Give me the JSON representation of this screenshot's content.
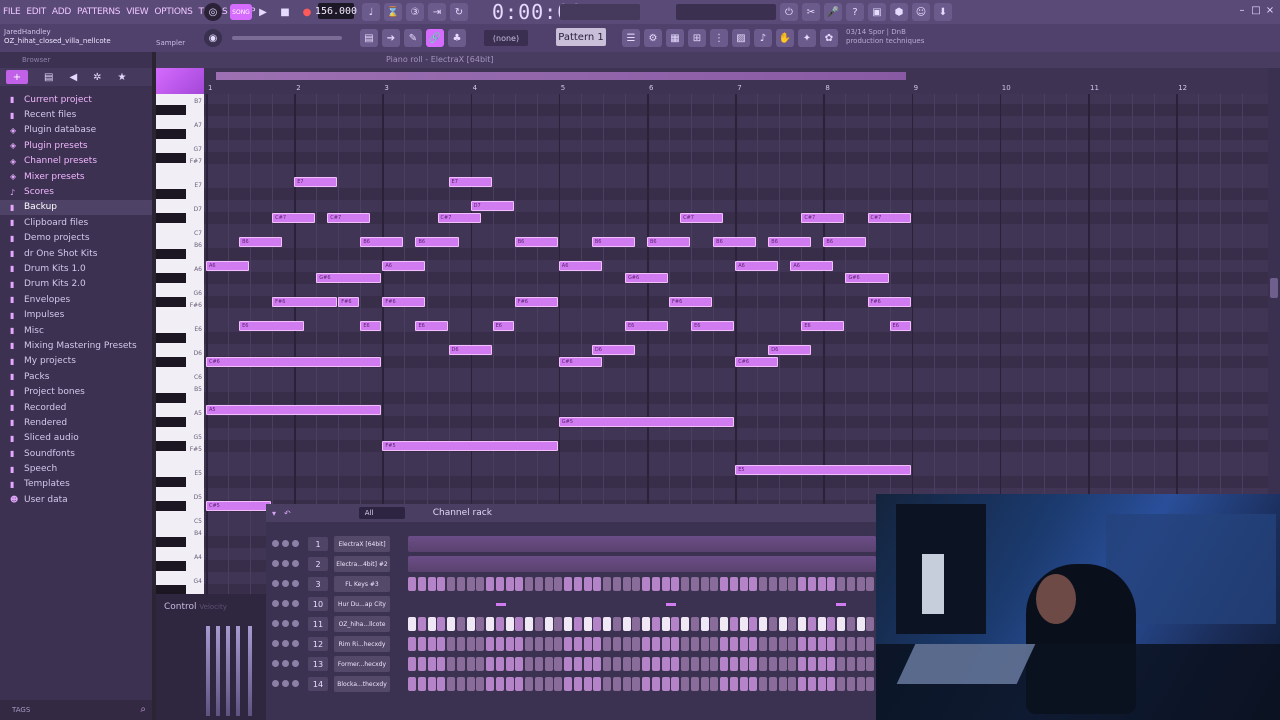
{
  "menubar": {
    "items": [
      "FILE",
      "EDIT",
      "ADD",
      "PATTERNS",
      "VIEW",
      "OPTIONS",
      "TOOLS",
      "HELP"
    ],
    "tempo": "156.000",
    "time": "0:00:00",
    "mode_badge": "SONG"
  },
  "project": {
    "user": "JaredHandley",
    "file": "OZ_hihat_closed_villa_nellcote",
    "plugin_label": "Sampler"
  },
  "toolbar": {
    "snap": "(none)",
    "pattern": "Pattern 1",
    "hint_line1": "03/14  Spor | DnB",
    "hint_line2": "production techniques"
  },
  "browser": {
    "title": "Browser",
    "items": [
      {
        "label": "Current project",
        "icon": "folder-icon",
        "pink": true
      },
      {
        "label": "Recent files",
        "icon": "folder-icon"
      },
      {
        "label": "Plugin database",
        "icon": "plug-icon"
      },
      {
        "label": "Plugin presets",
        "icon": "plug-icon",
        "pink": true
      },
      {
        "label": "Channel presets",
        "icon": "plug-icon",
        "pink": true
      },
      {
        "label": "Mixer presets",
        "icon": "plug-icon",
        "pink": true
      },
      {
        "label": "Scores",
        "icon": "note-icon",
        "pink": true
      },
      {
        "label": "Backup",
        "icon": "folder-icon",
        "highlight": true
      },
      {
        "label": "Clipboard files",
        "icon": "folder-icon"
      },
      {
        "label": "Demo projects",
        "icon": "folder-icon"
      },
      {
        "label": "dr One Shot Kits",
        "icon": "folder-icon"
      },
      {
        "label": "Drum Kits 1.0",
        "icon": "folder-icon"
      },
      {
        "label": "Drum Kits 2.0",
        "icon": "folder-icon"
      },
      {
        "label": "Envelopes",
        "icon": "folder-icon"
      },
      {
        "label": "Impulses",
        "icon": "folder-icon"
      },
      {
        "label": "Misc",
        "icon": "folder-icon"
      },
      {
        "label": "Mixing Mastering Presets",
        "icon": "folder-icon"
      },
      {
        "label": "My projects",
        "icon": "folder-icon"
      },
      {
        "label": "Packs",
        "icon": "folder-icon"
      },
      {
        "label": "Project bones",
        "icon": "folder-icon"
      },
      {
        "label": "Recorded",
        "icon": "folder-icon"
      },
      {
        "label": "Rendered",
        "icon": "folder-icon"
      },
      {
        "label": "Sliced audio",
        "icon": "folder-icon"
      },
      {
        "label": "Soundfonts",
        "icon": "folder-icon"
      },
      {
        "label": "Speech",
        "icon": "folder-icon"
      },
      {
        "label": "Templates",
        "icon": "folder-icon"
      },
      {
        "label": "User data",
        "icon": "user-icon"
      }
    ],
    "tags_label": "TAGS"
  },
  "piano_roll": {
    "title": "Piano roll - ElectraX [64bit]",
    "bars": [
      "1",
      "2",
      "3",
      "4",
      "5",
      "6",
      "7",
      "8",
      "9",
      "10",
      "11",
      "12"
    ],
    "key_labels": [
      {
        "label": "B7",
        "row": 1
      },
      {
        "label": "A7",
        "row": 3
      },
      {
        "label": "G7",
        "row": 5
      },
      {
        "label": "F#7",
        "row": 6
      },
      {
        "label": "E7",
        "row": 8
      },
      {
        "label": "D7",
        "row": 10
      },
      {
        "label": "C7",
        "row": 12
      },
      {
        "label": "B6",
        "row": 13
      },
      {
        "label": "A6",
        "row": 15
      },
      {
        "label": "G6",
        "row": 17
      },
      {
        "label": "F#6",
        "row": 18
      },
      {
        "label": "E6",
        "row": 20
      },
      {
        "label": "D6",
        "row": 22
      },
      {
        "label": "C6",
        "row": 24
      },
      {
        "label": "B5",
        "row": 25
      },
      {
        "label": "A5",
        "row": 27
      },
      {
        "label": "G5",
        "row": 29
      },
      {
        "label": "F#5",
        "row": 30
      },
      {
        "label": "E5",
        "row": 32
      },
      {
        "label": "D5",
        "row": 34
      },
      {
        "label": "C5",
        "row": 36
      },
      {
        "label": "B4",
        "row": 37
      },
      {
        "label": "A4",
        "row": 39
      },
      {
        "label": "G4",
        "row": 41
      }
    ],
    "notes": [
      {
        "label": "E7",
        "row": 8,
        "start": 1.0,
        "len": 0.5
      },
      {
        "label": "E7",
        "row": 8,
        "start": 2.75,
        "len": 0.5
      },
      {
        "label": "D7",
        "row": 10,
        "start": 3.0,
        "len": 0.5
      },
      {
        "label": "C#7",
        "row": 11,
        "start": 0.75,
        "len": 0.5
      },
      {
        "label": "C#7",
        "row": 11,
        "start": 1.375,
        "len": 0.5
      },
      {
        "label": "C#7",
        "row": 11,
        "start": 2.625,
        "len": 0.5
      },
      {
        "label": "C#7",
        "row": 11,
        "start": 5.375,
        "len": 0.5
      },
      {
        "label": "C#7",
        "row": 11,
        "start": 6.75,
        "len": 0.5
      },
      {
        "label": "C#7",
        "row": 11,
        "start": 7.5,
        "len": 0.5
      },
      {
        "label": "B6",
        "row": 13,
        "start": 0.375,
        "len": 0.5
      },
      {
        "label": "B6",
        "row": 13,
        "start": 1.75,
        "len": 0.5
      },
      {
        "label": "B6",
        "row": 13,
        "start": 2.375,
        "len": 0.5
      },
      {
        "label": "B6",
        "row": 13,
        "start": 3.5,
        "len": 0.5
      },
      {
        "label": "B6",
        "row": 13,
        "start": 4.375,
        "len": 0.5
      },
      {
        "label": "B6",
        "row": 13,
        "start": 5.0,
        "len": 0.5
      },
      {
        "label": "B6",
        "row": 13,
        "start": 5.75,
        "len": 0.5
      },
      {
        "label": "B6",
        "row": 13,
        "start": 6.375,
        "len": 0.5
      },
      {
        "label": "B6",
        "row": 13,
        "start": 7.0,
        "len": 0.5
      },
      {
        "label": "A6",
        "row": 15,
        "start": 0.0,
        "len": 0.5
      },
      {
        "label": "A6",
        "row": 15,
        "start": 2.0,
        "len": 0.5
      },
      {
        "label": "A6",
        "row": 15,
        "start": 4.0,
        "len": 0.5
      },
      {
        "label": "A6",
        "row": 15,
        "start": 6.0,
        "len": 0.5
      },
      {
        "label": "A6",
        "row": 15,
        "start": 6.625,
        "len": 0.5
      },
      {
        "label": "G#6",
        "row": 16,
        "start": 1.25,
        "len": 0.75
      },
      {
        "label": "G#6",
        "row": 16,
        "start": 4.75,
        "len": 0.5
      },
      {
        "label": "G#6",
        "row": 16,
        "start": 7.25,
        "len": 0.5
      },
      {
        "label": "F#6",
        "row": 18,
        "start": 0.75,
        "len": 0.75
      },
      {
        "label": "F#6",
        "row": 18,
        "start": 1.5,
        "len": 0.25
      },
      {
        "label": "F#6",
        "row": 18,
        "start": 2.0,
        "len": 0.5
      },
      {
        "label": "F#6",
        "row": 18,
        "start": 3.5,
        "len": 0.5
      },
      {
        "label": "F#6",
        "row": 18,
        "start": 5.25,
        "len": 0.5
      },
      {
        "label": "F#6",
        "row": 18,
        "start": 7.5,
        "len": 0.5
      },
      {
        "label": "E6",
        "row": 20,
        "start": 0.375,
        "len": 0.75
      },
      {
        "label": "E6",
        "row": 20,
        "start": 1.75,
        "len": 0.25
      },
      {
        "label": "E6",
        "row": 20,
        "start": 2.375,
        "len": 0.375
      },
      {
        "label": "E6",
        "row": 20,
        "start": 3.25,
        "len": 0.25
      },
      {
        "label": "E6",
        "row": 20,
        "start": 4.75,
        "len": 0.5
      },
      {
        "label": "E6",
        "row": 20,
        "start": 5.5,
        "len": 0.5
      },
      {
        "label": "E6",
        "row": 20,
        "start": 6.75,
        "len": 0.5
      },
      {
        "label": "E6",
        "row": 20,
        "start": 7.75,
        "len": 0.25
      },
      {
        "label": "D6",
        "row": 22,
        "start": 2.75,
        "len": 0.5
      },
      {
        "label": "D6",
        "row": 22,
        "start": 4.375,
        "len": 0.5
      },
      {
        "label": "D6",
        "row": 22,
        "start": 6.375,
        "len": 0.5
      },
      {
        "label": "C#6",
        "row": 23,
        "start": 0.0,
        "len": 2.0
      },
      {
        "label": "C#6",
        "row": 23,
        "start": 4.0,
        "len": 0.5
      },
      {
        "label": "C#6",
        "row": 23,
        "start": 6.0,
        "len": 0.5
      },
      {
        "label": "A5",
        "row": 27,
        "start": 0.0,
        "len": 2.0
      },
      {
        "label": "G#5",
        "row": 28,
        "start": 4.0,
        "len": 2.0
      },
      {
        "label": "F#5",
        "row": 30,
        "start": 2.0,
        "len": 2.0
      },
      {
        "label": "E5",
        "row": 32,
        "start": 6.0,
        "len": 2.0
      },
      {
        "label": "C#5",
        "row": 35,
        "start": 0.0,
        "len": 0.75
      }
    ]
  },
  "control": {
    "label": "Control",
    "sub": "Velocity"
  },
  "channel_rack": {
    "filter": "All",
    "title": "Channel rack",
    "channels": [
      {
        "num": "1",
        "name": "ElectraX [64bit]",
        "kind": "pattern"
      },
      {
        "num": "2",
        "name": "Electra...4bit] #2",
        "kind": "pattern"
      },
      {
        "num": "3",
        "name": "FL Keys #3",
        "kind": "steps",
        "on": []
      },
      {
        "num": "10",
        "name": "Hur Du...ap City",
        "kind": "pattern-small"
      },
      {
        "num": "11",
        "name": "OZ_hiha...llcote",
        "kind": "steps",
        "on": [
          0,
          2,
          4,
          6,
          8,
          10,
          12,
          14,
          16,
          18,
          20,
          22,
          24,
          26,
          28,
          30,
          32,
          34,
          36,
          38,
          40,
          42,
          44,
          46
        ]
      },
      {
        "num": "12",
        "name": "Rim Ri...hecxdy",
        "kind": "steps",
        "on": []
      },
      {
        "num": "13",
        "name": "Former...hecxdy",
        "kind": "steps",
        "on": []
      },
      {
        "num": "14",
        "name": "Blocka...thecxdy",
        "kind": "steps",
        "on": []
      }
    ]
  }
}
